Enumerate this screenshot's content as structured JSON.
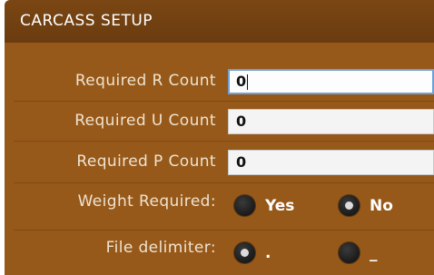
{
  "panel": {
    "title": "CARCASS SETUP"
  },
  "fields": [
    {
      "label": "Required R Count",
      "value": "0"
    },
    {
      "label": "Required U Count",
      "value": "0"
    },
    {
      "label": "Required P Count",
      "value": "0"
    }
  ],
  "weight_required": {
    "label": "Weight Required:",
    "options": [
      {
        "label": "Yes",
        "selected": false
      },
      {
        "label": "No",
        "selected": true
      }
    ]
  },
  "file_delimiter": {
    "label": "File delimiter:",
    "options": [
      {
        "label": ".",
        "selected": true
      },
      {
        "label": "_",
        "selected": false
      }
    ]
  },
  "colors": {
    "panel": "#97591a",
    "header": "#6f3f12",
    "focus": "#6fa0d6"
  }
}
